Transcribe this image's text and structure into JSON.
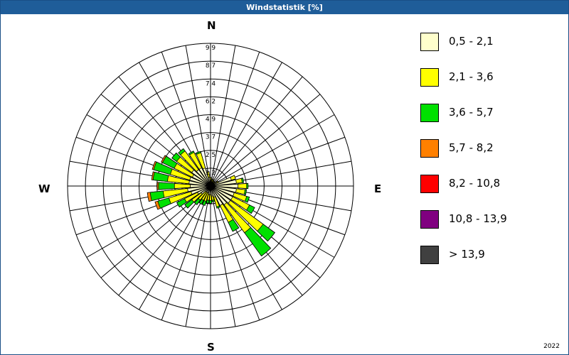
{
  "window": {
    "title": "Windstatistik [%]",
    "year": "2022"
  },
  "compass": {
    "north": "N",
    "east": "E",
    "south": "S",
    "west": "W"
  },
  "chart_data": {
    "type": "wind-rose",
    "title": "Windstatistik [%]",
    "unit": "%",
    "radial_max": 9.9,
    "ring_labels": [
      "1,2",
      "2,5",
      "3,7",
      "4,9",
      "6,2",
      "7,4",
      "8,7",
      "9,9"
    ],
    "sectors": 36,
    "sector_width_deg": 10,
    "speed_classes": [
      {
        "label": "0,5 - 2,1",
        "color": "#ffffcc"
      },
      {
        "label": "2,1 - 3,6",
        "color": "#ffff00"
      },
      {
        "label": "3,6 - 5,7",
        "color": "#00e000"
      },
      {
        "label": "5,7 - 8,2",
        "color": "#ff8000"
      },
      {
        "label": "8,2 - 10,8",
        "color": "#ff0000"
      },
      {
        "label": "10,8 - 13,9",
        "color": "#800080"
      },
      {
        "label": "> 13,9",
        "color": "#404040"
      }
    ],
    "cumulative_by_direction": [
      {
        "dir": 0,
        "values": [
          0.4,
          0.6,
          0.6,
          0.6
        ]
      },
      {
        "dir": 10,
        "values": [
          0.3,
          0.4,
          0.4,
          0.4
        ]
      },
      {
        "dir": 20,
        "values": [
          0.3,
          0.5,
          0.5,
          0.5
        ]
      },
      {
        "dir": 30,
        "values": [
          0.3,
          0.4,
          0.4,
          0.4
        ]
      },
      {
        "dir": 40,
        "values": [
          0.3,
          0.4,
          0.4,
          0.4
        ]
      },
      {
        "dir": 50,
        "values": [
          0.3,
          0.4,
          0.4,
          0.4
        ]
      },
      {
        "dir": 60,
        "values": [
          0.5,
          0.6,
          0.6,
          0.6
        ]
      },
      {
        "dir": 70,
        "values": [
          1.5,
          1.8,
          1.8,
          1.8
        ]
      },
      {
        "dir": 80,
        "values": [
          1.8,
          2.2,
          2.3,
          2.3
        ]
      },
      {
        "dir": 90,
        "values": [
          1.9,
          2.5,
          2.6,
          2.6
        ]
      },
      {
        "dir": 100,
        "values": [
          1.8,
          2.4,
          2.5,
          2.5
        ]
      },
      {
        "dir": 110,
        "values": [
          1.7,
          2.6,
          2.8,
          2.8
        ]
      },
      {
        "dir": 120,
        "values": [
          1.7,
          3.0,
          3.4,
          3.4
        ]
      },
      {
        "dir": 130,
        "values": [
          1.7,
          4.5,
          5.5,
          5.5
        ]
      },
      {
        "dir": 140,
        "values": [
          1.6,
          4.0,
          6.0,
          6.0
        ]
      },
      {
        "dir": 150,
        "values": [
          1.5,
          2.8,
          3.5,
          3.5
        ]
      },
      {
        "dir": 160,
        "values": [
          0.8,
          1.5,
          1.6,
          1.6
        ]
      },
      {
        "dir": 170,
        "values": [
          0.7,
          1.0,
          1.1,
          1.1
        ]
      },
      {
        "dir": 180,
        "values": [
          0.6,
          1.0,
          1.2,
          1.2
        ]
      },
      {
        "dir": 190,
        "values": [
          0.6,
          1.0,
          1.2,
          1.2
        ]
      },
      {
        "dir": 200,
        "values": [
          0.5,
          1.1,
          1.4,
          1.4
        ]
      },
      {
        "dir": 210,
        "values": [
          0.5,
          1.1,
          1.4,
          1.4
        ]
      },
      {
        "dir": 220,
        "values": [
          0.5,
          1.2,
          1.6,
          1.6
        ]
      },
      {
        "dir": 230,
        "values": [
          0.8,
          1.6,
          2.2,
          2.2
        ]
      },
      {
        "dir": 240,
        "values": [
          1.0,
          2.0,
          2.6,
          2.6
        ]
      },
      {
        "dir": 250,
        "values": [
          1.4,
          3.0,
          3.8,
          4.0
        ]
      },
      {
        "dir": 260,
        "values": [
          1.6,
          3.3,
          4.2,
          4.4
        ]
      },
      {
        "dir": 270,
        "values": [
          1.4,
          2.5,
          3.6,
          3.7
        ]
      },
      {
        "dir": 280,
        "values": [
          1.5,
          3.0,
          4.0,
          4.1
        ]
      },
      {
        "dir": 290,
        "values": [
          1.5,
          2.9,
          4.1,
          4.2
        ]
      },
      {
        "dir": 300,
        "values": [
          1.4,
          2.8,
          3.7,
          3.8
        ]
      },
      {
        "dir": 310,
        "values": [
          1.6,
          2.9,
          3.3,
          3.3
        ]
      },
      {
        "dir": 320,
        "values": [
          1.4,
          3.0,
          3.2,
          3.2
        ]
      },
      {
        "dir": 330,
        "values": [
          1.4,
          2.6,
          2.7,
          2.7
        ]
      },
      {
        "dir": 340,
        "values": [
          1.3,
          2.4,
          2.5,
          2.5
        ]
      },
      {
        "dir": 350,
        "values": [
          0.6,
          1.0,
          1.0,
          1.0
        ]
      }
    ],
    "legend_position": "right",
    "grid": true
  }
}
